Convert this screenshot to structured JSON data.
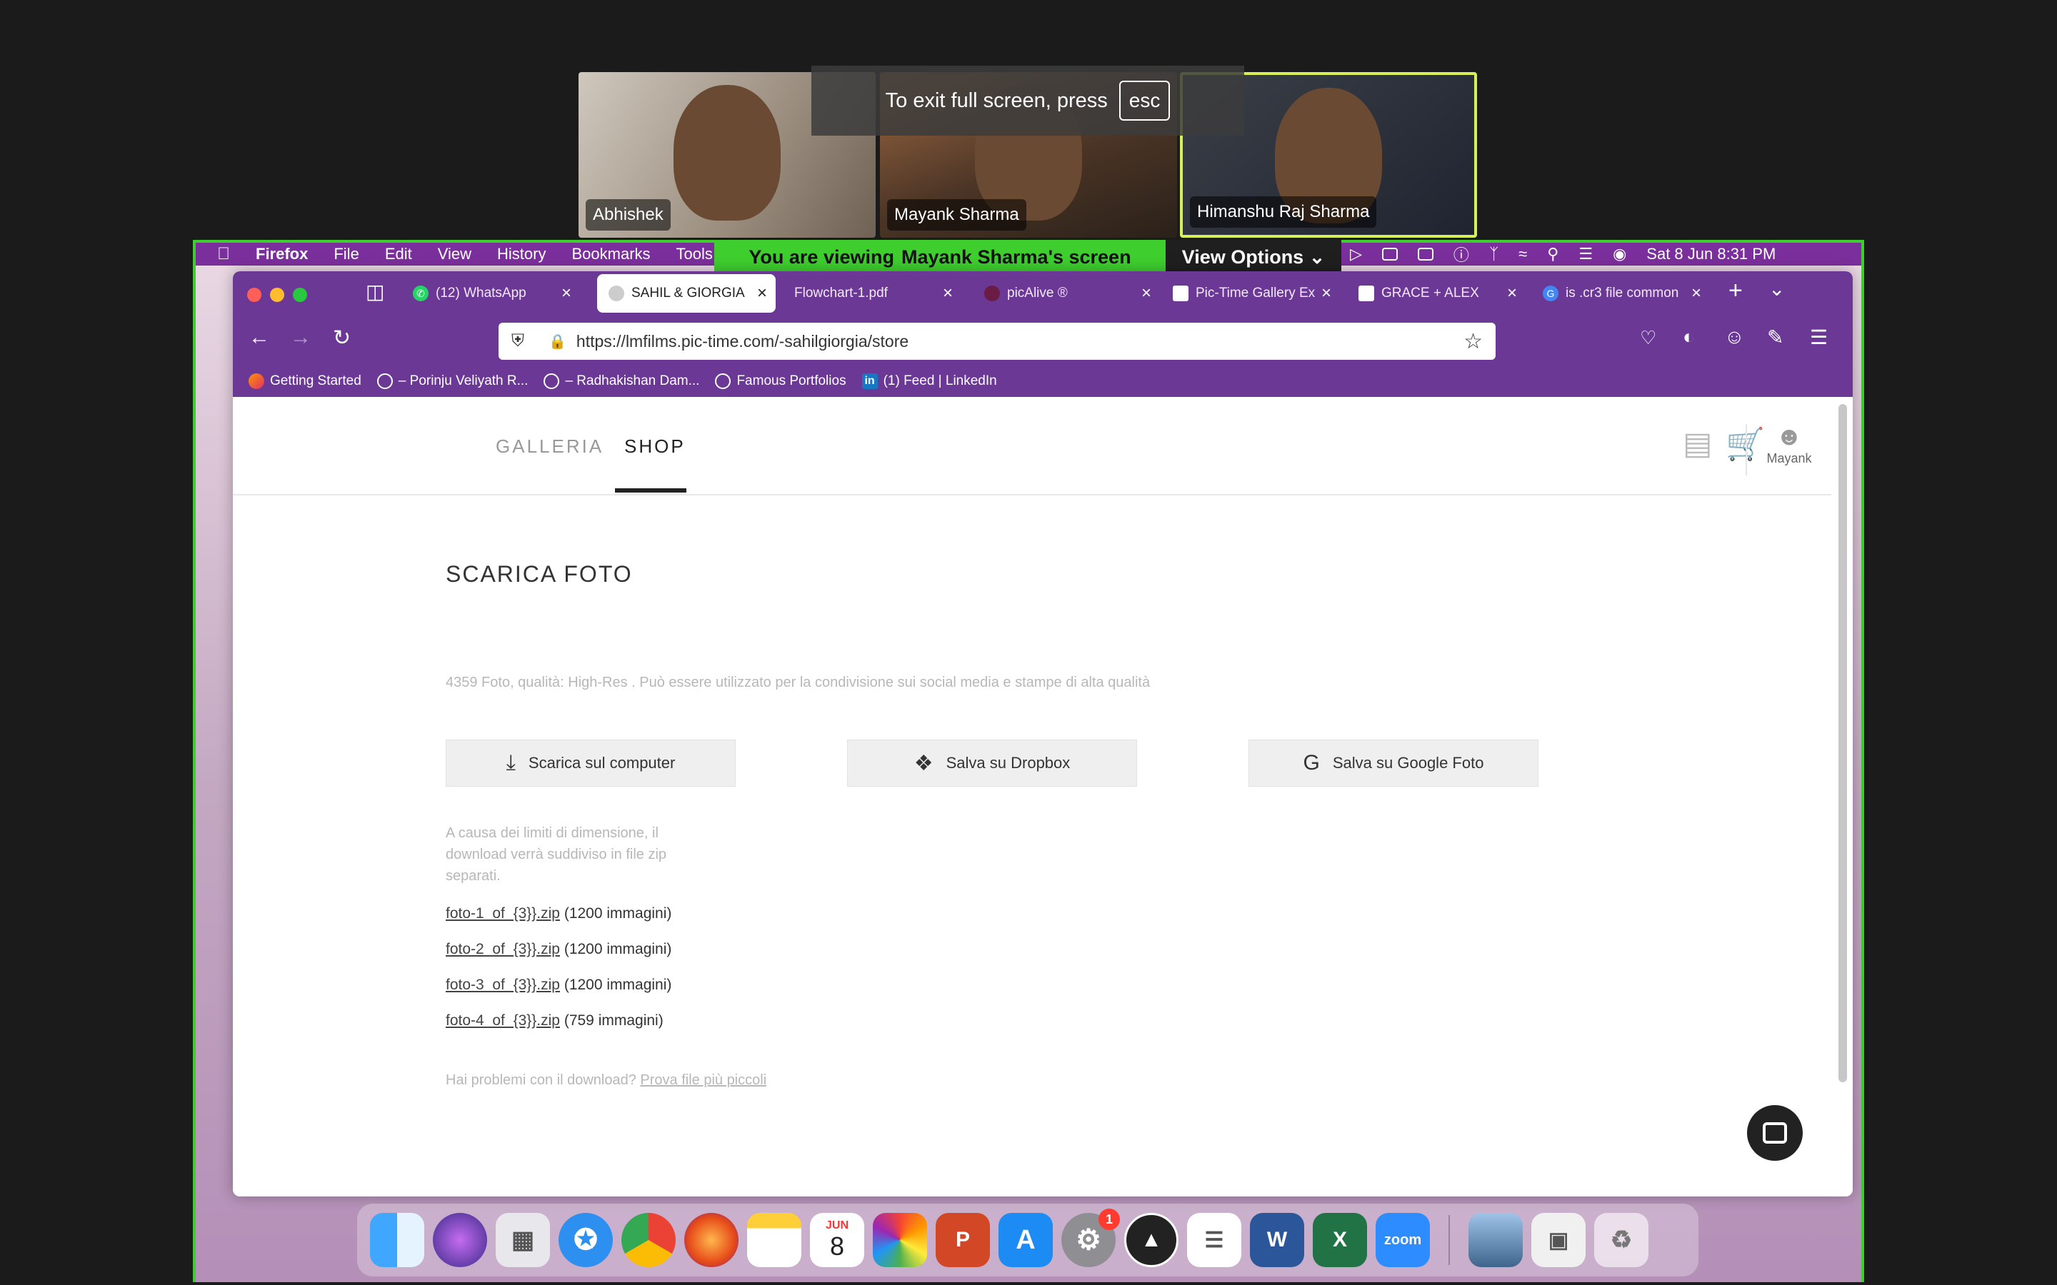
{
  "zoom": {
    "participants": [
      {
        "name": "Abhishek"
      },
      {
        "name": "Mayank Sharma"
      },
      {
        "name": "Himanshu Raj Sharma"
      }
    ],
    "fullscreen_message": "To exit full screen, press",
    "esc_key": "esc",
    "viewing_prefix": "You are viewing",
    "viewing_name": "Mayank Sharma's screen",
    "view_options": "View Options",
    "highlight_color": "#3ecf2e"
  },
  "mac_menubar": {
    "app": "Firefox",
    "items": [
      "File",
      "Edit",
      "View",
      "History",
      "Bookmarks",
      "Tools"
    ],
    "clock": "Sat 8 Jun  8:31 PM"
  },
  "browser": {
    "tabs": [
      {
        "label": "(12) WhatsApp"
      },
      {
        "label": "SAHIL & GIORGIA",
        "active": true
      },
      {
        "label": "Flowchart-1.pdf"
      },
      {
        "label": "picAlive ®"
      },
      {
        "label": "Pic-Time Gallery Ex"
      },
      {
        "label": "GRACE + ALEX"
      },
      {
        "label": "is .cr3 file common"
      }
    ],
    "url": "https://lmfilms.pic-time.com/-sahilgiorgia/store",
    "bookmarks": [
      "Getting Started",
      "– Porinju Veliyath R...",
      "– Radhakishan Dam...",
      "Famous Portfolios",
      "(1) Feed | LinkedIn"
    ],
    "theme_color": "#6b3896"
  },
  "site": {
    "nav": {
      "galleria": "GALLERIA",
      "shop": "SHOP",
      "user": "Mayank"
    },
    "title": "SCARICA FOTO",
    "description": "4359 Foto, qualità: High-Res . Può essere utilizzato per la condivisione sui social media e stampe di alta qualità",
    "buttons": {
      "computer": "Scarica sul computer",
      "dropbox": "Salva su Dropbox",
      "google": "Salva su Google Foto"
    },
    "note": "A causa dei limiti di dimensione, il download verrà suddiviso in file zip separati.",
    "zips": [
      {
        "file": "foto-1_of_{3}}.zip",
        "count": "(1200 immagini)"
      },
      {
        "file": "foto-2_of_{3}}.zip",
        "count": "(1200 immagini)"
      },
      {
        "file": "foto-3_of_{3}}.zip",
        "count": "(1200 immagini)"
      },
      {
        "file": "foto-4_of_{3}}.zip",
        "count": "(759 immagini)"
      }
    ],
    "help_prefix": "Hai problemi con il download?",
    "help_link": "Prova file più piccoli"
  },
  "dock": {
    "calendar_month": "JUN",
    "calendar_day": "8",
    "settings_badge": "1",
    "zoom_label": "zoom"
  }
}
